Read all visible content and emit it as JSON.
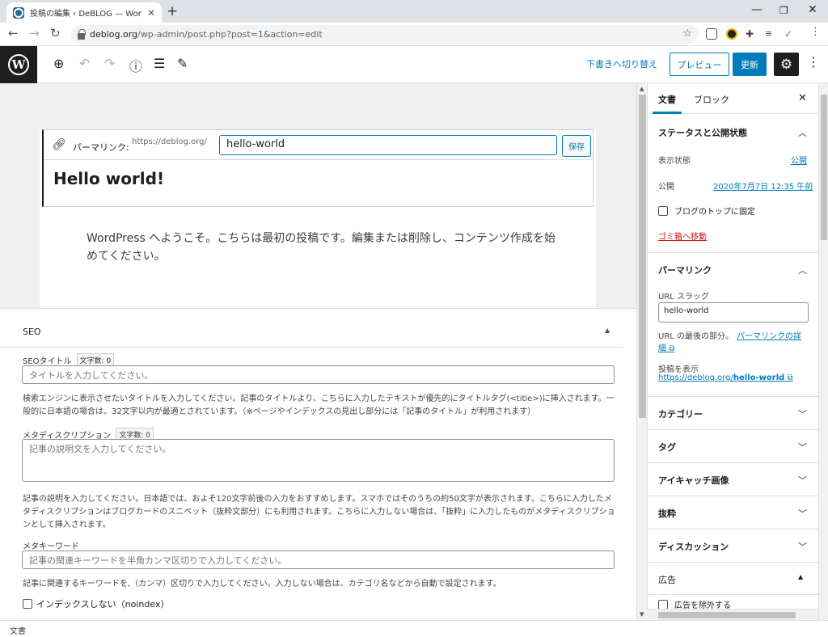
{
  "browser": {
    "tab_title": "投稿の編集 ‹ DeBLOG — WordPress",
    "url_domain": "deblog.org",
    "url_path": "/wp-admin/post.php?post=1&action=edit"
  },
  "header": {
    "switch_to_draft": "下書きへ切り替え",
    "preview": "プレビュー",
    "update": "更新"
  },
  "editor": {
    "permalink_label": "パーマリンク:",
    "permalink_prefix": "https://deblog.org/",
    "permalink_slug": "hello-world",
    "permalink_save": "保存",
    "post_title": "Hello world!",
    "post_body": "WordPress へようこそ。こちらは最初の投稿です。編集または削除し、コンテンツ作成を始めてください。"
  },
  "seo": {
    "heading": "SEO",
    "title_label": "SEOタイトル",
    "title_count": "文字数: 0",
    "title_placeholder": "タイトルを入力してください。",
    "title_help": "検索エンジンに表示させたいタイトルを入力してください。記事のタイトルより、こちらに入力したテキストが優先的にタイトルタグ(<title>)に挿入されます。一般的に日本語の場合は、32文字以内が最適とされています。（※ページやインデックスの見出し部分には「記事のタイトル」が利用されます）",
    "desc_label": "メタディスクリプション",
    "desc_count": "文字数: 0",
    "desc_placeholder": "記事の説明文を入力してください。",
    "desc_help": "記事の説明を入力してください。日本語では、およそ120文字前後の入力をおすすめします。スマホではそのうちの約50文字が表示されます。こちらに入力したメタディスクリプションはブログカードのスニペット（抜粋文部分）にも利用されます。こちらに入力しない場合は、「抜粋」に入力したものがメタディスクリプションとして挿入されます。",
    "keyword_label": "メタキーワード",
    "keyword_placeholder": "記事の関連キーワードを半角カンマ区切りで入力してください。",
    "keyword_help": "記事に関連するキーワードを,（カンマ）区切りで入力してください。入力しない場合は、カテゴリ名などから自動で設定されます。",
    "noindex_label": "インデックスしない（noindex）"
  },
  "sidebar": {
    "tab_document": "文書",
    "tab_block": "ブロック",
    "status_title": "ステータスと公開状態",
    "visibility_label": "表示状態",
    "visibility_value": "公開",
    "publish_label": "公開",
    "publish_value": "2020年7月7日 12:35 午前",
    "stick_label": "ブログのトップに固定",
    "trash": "ゴミ箱へ移動",
    "permalink_title": "パーマリンク",
    "url_slug_label": "URL スラッグ",
    "url_slug_value": "hello-world",
    "url_help": "URL の最後の部分。",
    "url_help_link_1": "パーマリンクの詳",
    "url_help_link_2": "細",
    "view_post_label": "投稿を表示",
    "view_post_prefix": "https://deblog.org/",
    "view_post_slug": "hello-world",
    "category": "カテゴリー",
    "tags": "タグ",
    "featured_image": "アイキャッチ画像",
    "excerpt": "抜粋",
    "discussion": "ディスカッション",
    "ads": "広告",
    "exclude_ads": "広告を除外する"
  },
  "footer": {
    "breadcrumb": "文書"
  },
  "colors": {
    "accent": "#007cba",
    "danger": "#cc1818",
    "wp_dark": "#1e1e1e"
  }
}
